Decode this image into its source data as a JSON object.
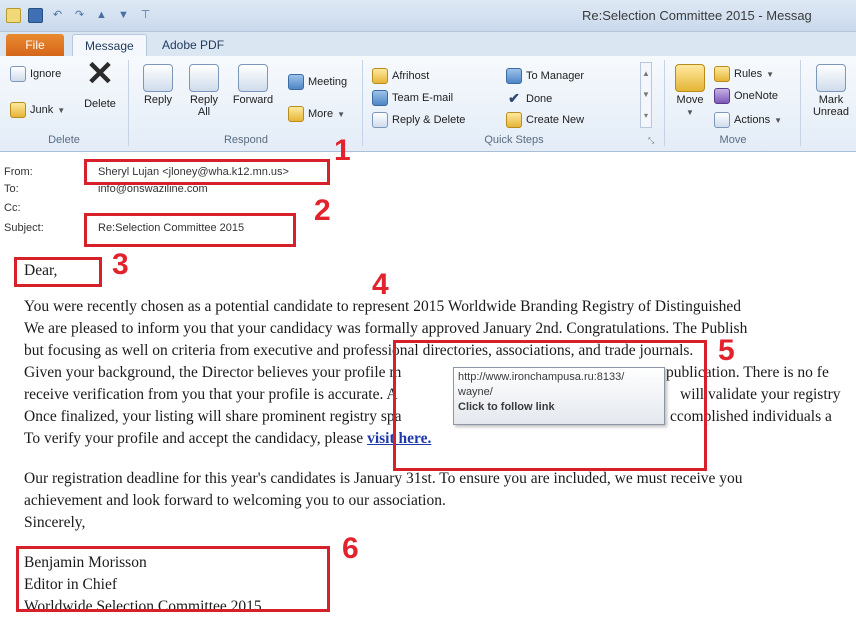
{
  "window": {
    "title": "Re:Selection Committee 2015 - Messag",
    "qat_icons": [
      "mail-icon",
      "save-icon",
      "undo-icon",
      "redo-icon",
      "up-arrow-icon",
      "down-arrow-icon",
      "customize-icon"
    ]
  },
  "tabs": [
    {
      "label": "File"
    },
    {
      "label": "Message"
    },
    {
      "label": "Adobe PDF"
    }
  ],
  "ribbon": {
    "delete_group": {
      "label": "Delete",
      "ignore": "Ignore",
      "junk": "Junk",
      "delete": "Delete"
    },
    "respond_group": {
      "label": "Respond",
      "reply": "Reply",
      "reply_all_1": "Reply",
      "reply_all_2": "All",
      "forward": "Forward",
      "meeting": "Meeting",
      "more": "More"
    },
    "quicksteps_group": {
      "label": "Quick Steps",
      "items": [
        "Afrihost",
        "Team E-mail",
        "Reply & Delete",
        "To Manager",
        "Done",
        "Create New"
      ]
    },
    "move_group": {
      "label": "Move",
      "move": "Move",
      "rules": "Rules",
      "onenote": "OneNote",
      "actions": "Actions"
    },
    "tags_group": {
      "mark_1": "Mark",
      "mark_2": "Unread"
    }
  },
  "header": {
    "from_label": "From:",
    "from_value": "Sheryl Lujan <jloney@wha.k12.mn.us>",
    "to_label": "To:",
    "to_value": "info@onswaziline.com",
    "cc_label": "Cc:",
    "subject_label": "Subject:",
    "subject_value": "Re:Selection Committee 2015"
  },
  "body": {
    "greeting": "Dear,",
    "lines": [
      "You were recently chosen as a potential candidate to represent 2015 Worldwide Branding Registry of Distinguished",
      "We are pleased to inform you that your candidacy was formally approved January 2nd. Congratulations. The Publish",
      "but focusing as well on criteria from executive and professional directories, associations, and trade journals.",
      "Given your background, the Director believes your profile m",
      "receive verification from you that your profile is accurate. A",
      "Once finalized, your listing will share prominent registry spa",
      "To verify your profile and accept the candidacy, please "
    ],
    "line4_right": "publication. There is no fe",
    "line5_right": "will validate your registry",
    "line6_right": "ccomplished individuals a",
    "link_text": "visit here.",
    "para2_line1": "Our registration deadline for this year's candidates is January 31st. To ensure you are included, we must receive you",
    "para2_line2": "achievement and look forward to welcoming you to our association.",
    "closing": "Sincerely,",
    "signature": [
      "Benjamin Morisson",
      "Editor in Chief",
      "Worldwide Selection Committee 2015"
    ]
  },
  "tooltip": {
    "url_line1": "http://www.ironchampusa.ru:8133/",
    "url_line2": "wayne/",
    "action": "Click to follow link"
  },
  "annotations": [
    "1",
    "2",
    "3",
    "4",
    "5",
    "6"
  ],
  "colors": {
    "annotation": "#d6202a",
    "file_tab": "#d5661a",
    "link": "#1f3aa8"
  }
}
